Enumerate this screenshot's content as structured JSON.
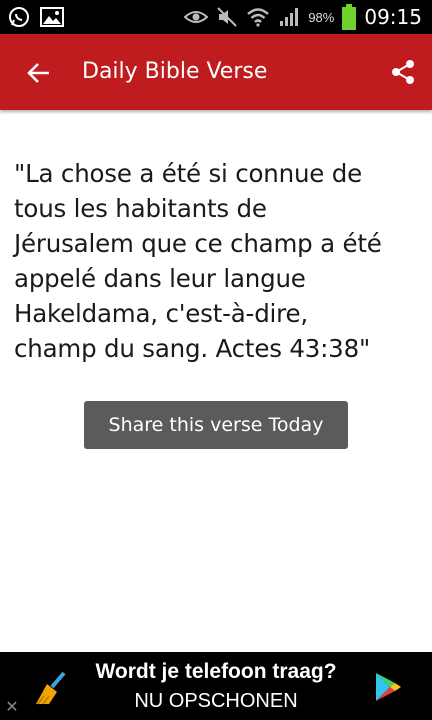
{
  "status_bar": {
    "battery_percent": "98%",
    "time": "09:15",
    "icons": [
      "whatsapp-icon",
      "gallery-icon",
      "eye-icon",
      "mute-icon",
      "wifi-icon",
      "signal-icon",
      "battery-icon"
    ]
  },
  "app_bar": {
    "title": "Daily Bible Verse",
    "back_icon": "arrow-back-icon",
    "share_icon": "share-icon",
    "color": "#bf1c1f"
  },
  "content": {
    "verse_lines": [
      "\"La chose a été si connue de",
      "tous les habitants de",
      "Jérusalem que ce champ a été",
      "appelé dans leur langue",
      "Hakeldama, c'est-à-dire,",
      "champ du sang. Actes 43:38\""
    ],
    "share_button_label": "Share this verse Today"
  },
  "ad": {
    "headline": "Wordt je telefoon traag?",
    "cta": "NU OPSCHONEN",
    "close_label": "✕"
  }
}
